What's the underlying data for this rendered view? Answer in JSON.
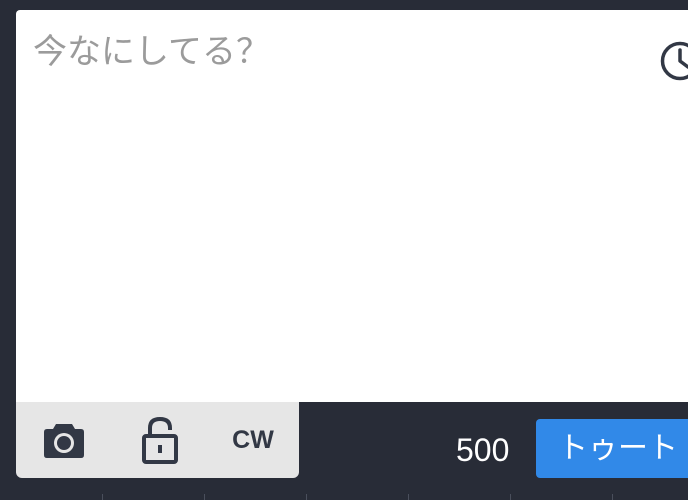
{
  "compose": {
    "placeholder": "今なにしてる？",
    "value": ""
  },
  "schedule": {
    "icon": "clock-icon"
  },
  "toolbar": {
    "camera_icon": "camera-icon",
    "privacy_icon": "unlock-icon",
    "cw_label": "CW"
  },
  "counter": {
    "remaining": "500"
  },
  "submit": {
    "label": "トゥート"
  },
  "colors": {
    "background": "#282c37",
    "compose_bg": "#ffffff",
    "toolbar_bg": "#e6e6e6",
    "accent": "#3189e8",
    "icon": "#323845"
  }
}
